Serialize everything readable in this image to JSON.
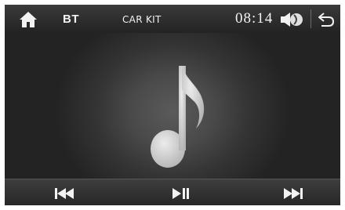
{
  "status_bar": {
    "home_icon": "home-icon",
    "source_label": "BT",
    "mode_label": "CAR KIT",
    "time": "08:14",
    "volume_icon": "speaker-icon",
    "back_icon": "back-arrow-icon"
  },
  "main": {
    "artwork_icon": "music-note-icon"
  },
  "controls": {
    "previous_icon": "skip-previous-icon",
    "play_pause_icon": "play-pause-icon",
    "next_icon": "skip-next-icon"
  },
  "colors": {
    "background": "#1d1d1d",
    "bar": "#2c2c2c",
    "glyph": "#f2f2f2",
    "note": "#d0d0d0"
  }
}
